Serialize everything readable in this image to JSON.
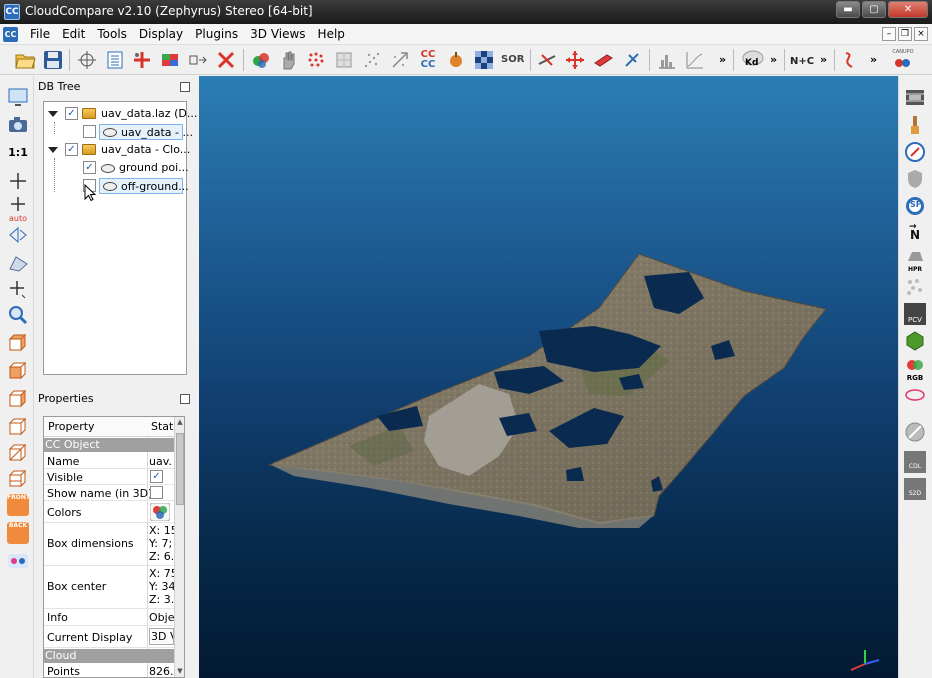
{
  "window": {
    "title": "CloudCompare v2.10 (Zephyrus) Stereo [64-bit]",
    "app_icon_text": "CC",
    "minimize": "▬",
    "maximize": "▢",
    "close": "✕"
  },
  "menubar": {
    "items": [
      "File",
      "Edit",
      "Tools",
      "Display",
      "Plugins",
      "3D Views",
      "Help"
    ]
  },
  "toolbar": {
    "more": "»",
    "sor_label": "SOR",
    "cc_label": "CC",
    "kd_label": "Kd",
    "nc_label": "N+C",
    "canupo_label": "CANUPO"
  },
  "left_toolbar": {
    "scale_label": "1:1",
    "auto_label": "auto",
    "front_label": "FRONT",
    "back_label": "BACK"
  },
  "right_toolbar": {
    "hpr_label": "HPR",
    "pcv_label": "PCV",
    "rgb_label": "RGB",
    "n_label": "N",
    "sf_label": "SF",
    "cdl_label": "CDL",
    "s2d_label": "S2D"
  },
  "db_tree": {
    "title": "DB Tree",
    "items": [
      {
        "label": "uav_data.laz (D...",
        "checked": true
      },
      {
        "label": "uav_data - ...",
        "checked": false
      },
      {
        "label": "uav_data - Clo...",
        "checked": true
      },
      {
        "label": "ground poi...",
        "checked": true
      },
      {
        "label": "off-ground...",
        "checked": false
      }
    ]
  },
  "properties": {
    "title": "Properties",
    "col_property": "Property",
    "col_state": "Stat",
    "section_object": "CC Object",
    "section_cloud": "Cloud",
    "rows": {
      "name": {
        "label": "Name",
        "value": "uav."
      },
      "visible": {
        "label": "Visible"
      },
      "show_name": {
        "label": "Show name (in 3D)"
      },
      "colors": {
        "label": "Colors"
      },
      "box_dims": {
        "label": "Box dimensions",
        "x": "X: 15",
        "y": "Y: 7;",
        "z": "Z: 6."
      },
      "box_center": {
        "label": "Box center",
        "x": "X: 75",
        "y": "Y: 34",
        "z": "Z: 3."
      },
      "info": {
        "label": "Info",
        "value": "Obje"
      },
      "current_display": {
        "label": "Current Display",
        "value": "3D V"
      },
      "points": {
        "label": "Points",
        "value": "826."
      }
    }
  },
  "colors": {
    "accent": "#2c6cb8",
    "selection": "#e5f1fb",
    "section": "#a0a0a0"
  }
}
